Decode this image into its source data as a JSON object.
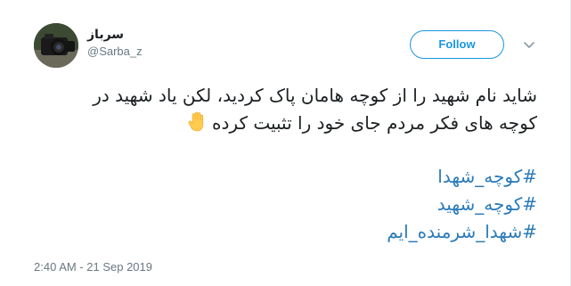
{
  "author": {
    "display_name": "سرباز",
    "handle": "@Sarba_z",
    "avatar_icon": "camera-photo-avatar"
  },
  "follow_button": {
    "label": "Follow",
    "color": "#1b95e0"
  },
  "menu_icon": "chevron-down-icon",
  "tweet": {
    "lines": [
      "شاید نام شهید را از کوچه هامان پاک کردید، لکن یاد شهید در",
      "کوچه های فکر مردم جای خود را تثبیت کرده"
    ],
    "emoji": "raised-hand-icon",
    "hashtags": [
      "#کوچه_شهدا",
      "#کوچه_شهید",
      "#شهدا_شرمنده_ایم"
    ],
    "hashtag_color": "#2b7bb9"
  },
  "timestamp": "2:40 AM - 21 Sep 2019"
}
